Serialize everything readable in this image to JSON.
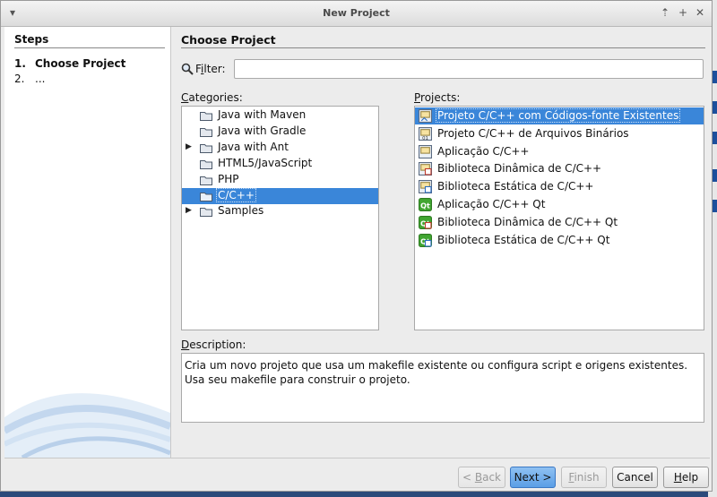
{
  "window": {
    "title": "New Project",
    "titlebar_buttons": [
      "▾",
      "⇡",
      "+",
      "✕"
    ]
  },
  "steps": {
    "header": "Steps",
    "items": [
      {
        "num": "1.",
        "label": "Choose Project"
      },
      {
        "num": "2.",
        "label": "..."
      }
    ]
  },
  "main": {
    "title": "Choose Project",
    "filter": {
      "label_pre": "F",
      "label_u": "i",
      "label_post": "lter:",
      "value": ""
    },
    "categories": {
      "label_u": "C",
      "label_rest": "ategories:",
      "items": [
        {
          "label": "Java with Maven",
          "expandable": false,
          "selected": false
        },
        {
          "label": "Java with Gradle",
          "expandable": false,
          "selected": false
        },
        {
          "label": "Java with Ant",
          "expandable": true,
          "selected": false
        },
        {
          "label": "HTML5/JavaScript",
          "expandable": false,
          "selected": false
        },
        {
          "label": "PHP",
          "expandable": false,
          "selected": false
        },
        {
          "label": "C/C++",
          "expandable": false,
          "selected": true
        },
        {
          "label": "Samples",
          "expandable": true,
          "selected": false
        }
      ]
    },
    "projects": {
      "label_u": "P",
      "label_rest": "rojects:",
      "items": [
        {
          "label": "Projeto C/C++ com Códigos-fonte Existentes",
          "icon": "existing-sources-icon",
          "selected": true
        },
        {
          "label": "Projeto C/C++ de Arquivos Binários",
          "icon": "binary-files-icon",
          "selected": false
        },
        {
          "label": "Aplicação C/C++",
          "icon": "application-icon",
          "selected": false
        },
        {
          "label": "Biblioteca Dinâmica de C/C++",
          "icon": "dynamic-library-icon",
          "selected": false
        },
        {
          "label": "Biblioteca Estática de C/C++",
          "icon": "static-library-icon",
          "selected": false
        },
        {
          "label": "Aplicação C/C++ Qt",
          "icon": "qt-application-icon",
          "selected": false
        },
        {
          "label": "Biblioteca Dinâmica de C/C++ Qt",
          "icon": "qt-dynamic-library-icon",
          "selected": false
        },
        {
          "label": "Biblioteca Estática de C/C++ Qt",
          "icon": "qt-static-library-icon",
          "selected": false
        }
      ]
    },
    "description": {
      "label_u": "D",
      "label_rest": "escription:",
      "text": "Cria um novo projeto que usa um makefile existente ou configura script e origens existentes. Usa seu makefile para construir o projeto."
    }
  },
  "buttons": {
    "back": {
      "pre": "< ",
      "u": "B",
      "post": "ack",
      "enabled": false
    },
    "next": {
      "pre": "Next >",
      "u": "",
      "post": "",
      "enabled": true
    },
    "finish": {
      "pre": "",
      "u": "F",
      "post": "inish",
      "enabled": false
    },
    "cancel": {
      "pre": "Cancel",
      "u": "",
      "post": "",
      "enabled": true
    },
    "help": {
      "pre": "",
      "u": "H",
      "post": "elp",
      "enabled": true
    }
  },
  "colors": {
    "selection": "#3a86d9",
    "primary_button": "#5a9ee6",
    "qt_green": "#41a631"
  }
}
